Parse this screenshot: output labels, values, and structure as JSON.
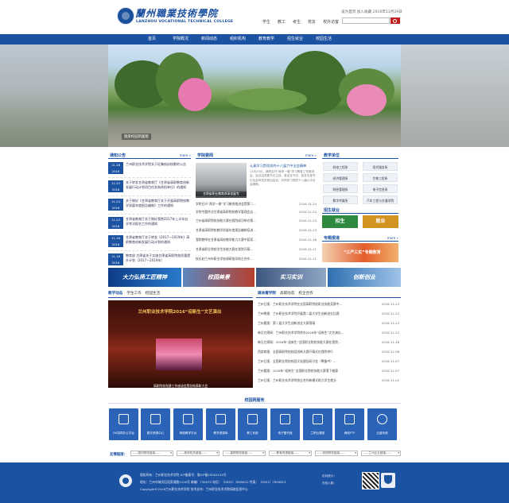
{
  "header": {
    "logo_cn": "蘭州職業技術學院",
    "logo_en": "LANZHOU VOCATIONAL TECHNICAL COLLEGE",
    "top_links": "设为首页  加入收藏  2016年11月29日",
    "quick": [
      "学生",
      "教工",
      "考生",
      "校友",
      "校外访客"
    ],
    "search_placeholder": ""
  },
  "nav": [
    "首页",
    "学院概况",
    "新闻动态",
    "组织机构",
    "教育教学",
    "招生就业",
    "校园生活"
  ],
  "banner": {
    "caption": "陇梁校园新面貌"
  },
  "notices": {
    "title": "通知公告",
    "more": "more",
    "items": [
      {
        "md": "11-28",
        "y": "2016",
        "text": "兰州职业技术学院关于征集校训校歌的公告"
      },
      {
        "md": "11-25",
        "y": "2016",
        "text": "关于转发甘肃省教育厅《甘肃省高职教育创新发展行动计划项目任务和承担单位》的通知"
      },
      {
        "md": "11-24",
        "y": "2016",
        "text": "关于做好《甘肃省教育厅关于开展高职院校教学质量年度报告编制》工作的通知"
      },
      {
        "md": "11-24",
        "y": "2016",
        "text": "甘肃省教育厅关于做好我院2017年上半年自学考试报名工作的通知"
      },
      {
        "md": "11-16",
        "y": "2016",
        "text": "甘肃省教育厅关于转发《2017—2019年》高职教育创新发展行动计划的通知"
      },
      {
        "md": "11-16",
        "y": "2016",
        "text": "教育部 甘肃省关于实施甘肃省高职院校质量提升计划（2017—2019年）"
      },
      {
        "md": "11-16",
        "y": "2016",
        "text": "关于开展“中国梦”CNKI系列微视频主题征集活动的通知"
      }
    ]
  },
  "news": {
    "title": "学院要闻",
    "more": "more",
    "image_caption": "甘肃省职业教育改革发展专",
    "feature_title": "认真学习贯彻党的十八届六中全会精神",
    "feature_body": "11月25日，我院召开“两学一做”学习教育工作推进会。会议由党委书记主持，各总支书记、各党支部书记及全体党员参加会议，共同学习党的十八届六中全会精神。",
    "items": [
      {
        "text": "学院召开“两学一做”学习教育推进会暨第二...",
        "date": "2016-11-24"
      },
      {
        "text": "学院专题传达甘肃省高职院校教学管理会议...",
        "date": "2016-11-24"
      },
      {
        "text": "兰州省高职院校技能大赛在我院成功举办第...",
        "date": "2016-11-23"
      },
      {
        "text": "甘肃省高职院校教学质量年度报告编制培训...",
        "date": "2016-11-23"
      },
      {
        "text": "我院教师在甘肃省高校教学能力大赛中获奖...",
        "date": "2016-11-16"
      },
      {
        "text": "甘肃省职业院校学生技能大赛在我院开幕...",
        "date": "2016-11-11"
      },
      {
        "text": "校长赴兰州市职业学校调研指导校企合作...",
        "date": "2016-11-11"
      }
    ]
  },
  "depts": {
    "title": "教学单位",
    "items": [
      "机电工程系",
      "现代服务系",
      "经济管理系",
      "生物工程系",
      "财经管理系",
      "电子信息系",
      "数字传媒系",
      "汽车工程与交通学院"
    ]
  },
  "enroll": {
    "title": "招生就业",
    "zs": "招生",
    "jy": "就业"
  },
  "special": {
    "title": "专题报道",
    "more": "more",
    "text": "“三严三实”专题教育"
  },
  "ads": [
    "大力弘扬工匠精神",
    "校园美景",
    "实习实训",
    "创新创业"
  ],
  "lower_tabs_left": [
    "教学动态",
    "学生工作",
    "校园生活"
  ],
  "lower_tabs_right": [
    "媒体看学院",
    "高职动态",
    "校企合作"
  ],
  "stage": {
    "banner": "兰州职业技术学院2016“迎新生”文艺演出",
    "caption": "高职院校党建工作座谈会暨总结表彰大会"
  },
  "media": [
    {
      "text": "兰州日报：兰州职业技术学院在全国高职院校职业技能竞赛中...",
      "date": "2016-11-23"
    },
    {
      "text": "兰州晚报：兰州职业技术学院开展第二届大学生创新创业比赛",
      "date": "2016-11-23"
    },
    {
      "text": "兰州晨报：第二届大学生创新创业大赛落幕",
      "date": "2016-11-23"
    },
    {
      "text": "每日甘肃网：兰州职业技术学院举办2016年“迎新生”文艺演出...",
      "date": "2016-11-23"
    },
    {
      "text": "每日甘肃网：2016年“迎新生”全国职业院校技能大赛在我院...",
      "date": "2016-11-18"
    },
    {
      "text": "西部商报：全国高职院校校园创新大赛开幕式在我院举行",
      "date": "2016-11-08"
    },
    {
      "text": "兰州日报：全国职业院校校园文化建设研讨会（筹备中）...",
      "date": "2016-11-07"
    },
    {
      "text": "兰州晨报：2016年“迎新生”全国职业院校技能大赛落下帷幕",
      "date": "2016-11-07"
    },
    {
      "text": "兰州日报：兰州职业技术学院校企合作新模式助力学生就业",
      "date": "2016-11-02"
    }
  ],
  "services": {
    "title": "校园网服务",
    "items": [
      "OA协同办公平台",
      "数字资源中心",
      "网络教学平台",
      "教学资源库",
      "教工系统",
      "电子图书馆",
      "兰职云课堂",
      "网络FTP",
      "云盘系统"
    ]
  },
  "links": {
    "label": "友情链接：",
    "selects": [
      "-----国内院校链接-----",
      "-----政府机关链接-----",
      "-----高职院校链接-----",
      "-----教育资源链接-----",
      "-----其他院校链接-----",
      "-----兰州企业链接-----"
    ]
  },
  "footer": {
    "lines": [
      "版权所有：兰州职业技术学院    ICP备案号：陇ICP备15002154号",
      "地址：兰州市城关区段家滩路1100号    邮编：730070    电话：（0931）7659812    传真：（0931）7659813",
      "Copyright©2016兰州职业技术学院    技术支持：兰州职业技术学院网络信息中心"
    ],
    "right": [
      "访问统计：",
      "在线人数："
    ]
  },
  "colors": {
    "primary": "#1c52a2",
    "accent": "#c41e1e"
  }
}
